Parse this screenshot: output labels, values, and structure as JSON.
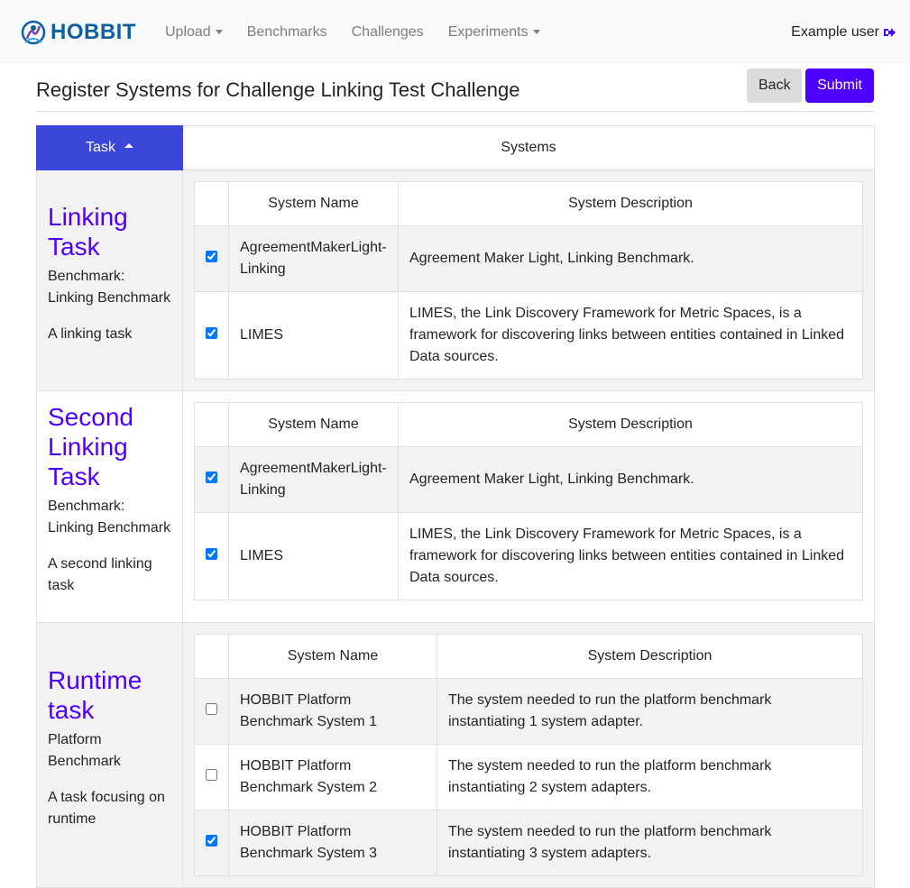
{
  "brand": {
    "name": "HOBBIT",
    "logo_icon": "hobbit-logo-icon"
  },
  "nav": {
    "items": [
      {
        "label": "Upload",
        "dropdown": true
      },
      {
        "label": "Benchmarks",
        "dropdown": false
      },
      {
        "label": "Challenges",
        "dropdown": false
      },
      {
        "label": "Experiments",
        "dropdown": true
      }
    ],
    "user_label": "Example user",
    "user_icon": "sign-out-icon"
  },
  "page": {
    "title": "Register Systems for Challenge Linking Test Challenge",
    "back_label": "Back",
    "submit_label": "Submit"
  },
  "table": {
    "header_task": "Task",
    "header_systems": "Systems",
    "col_system_name": "System Name",
    "col_system_description": "System Description"
  },
  "tasks": [
    {
      "name": "Linking Task",
      "benchmark": "Benchmark: Linking Benchmark",
      "description": "A linking task",
      "systems": [
        {
          "name": "AgreementMakerLight-Linking",
          "description": "Agreement Maker Light, Linking Benchmark.",
          "checked": true
        },
        {
          "name": "LIMES",
          "description": "LIMES, the Link Discovery Framework for Metric Spaces, is a framework for discovering links between entities contained in Linked Data sources.",
          "checked": true
        }
      ]
    },
    {
      "name": "Second Linking Task",
      "benchmark": "Benchmark: Linking Benchmark",
      "description": "A second linking task",
      "systems": [
        {
          "name": "AgreementMakerLight-Linking",
          "description": "Agreement Maker Light, Linking Benchmark.",
          "checked": true
        },
        {
          "name": "LIMES",
          "description": "LIMES, the Link Discovery Framework for Metric Spaces, is a framework for discovering links between entities contained in Linked Data sources.",
          "checked": true
        }
      ]
    },
    {
      "name": "Runtime task",
      "benchmark": "Platform Benchmark",
      "description": "A task focusing on runtime",
      "systems": [
        {
          "name": "HOBBIT Platform Benchmark System 1",
          "description": "The system needed to run the platform benchmark instantiating 1 system adapter.",
          "checked": false
        },
        {
          "name": "HOBBIT Platform Benchmark System 2",
          "description": "The system needed to run the platform benchmark instantiating 2 system adapters.",
          "checked": false
        },
        {
          "name": "HOBBIT Platform Benchmark System 3",
          "description": "The system needed to run the platform benchmark instantiating 3 system adapters.",
          "checked": true
        }
      ]
    }
  ],
  "colors": {
    "accent": "#4e00ff",
    "task_header": "#3c46d9",
    "brand": "#0d5fa0"
  }
}
